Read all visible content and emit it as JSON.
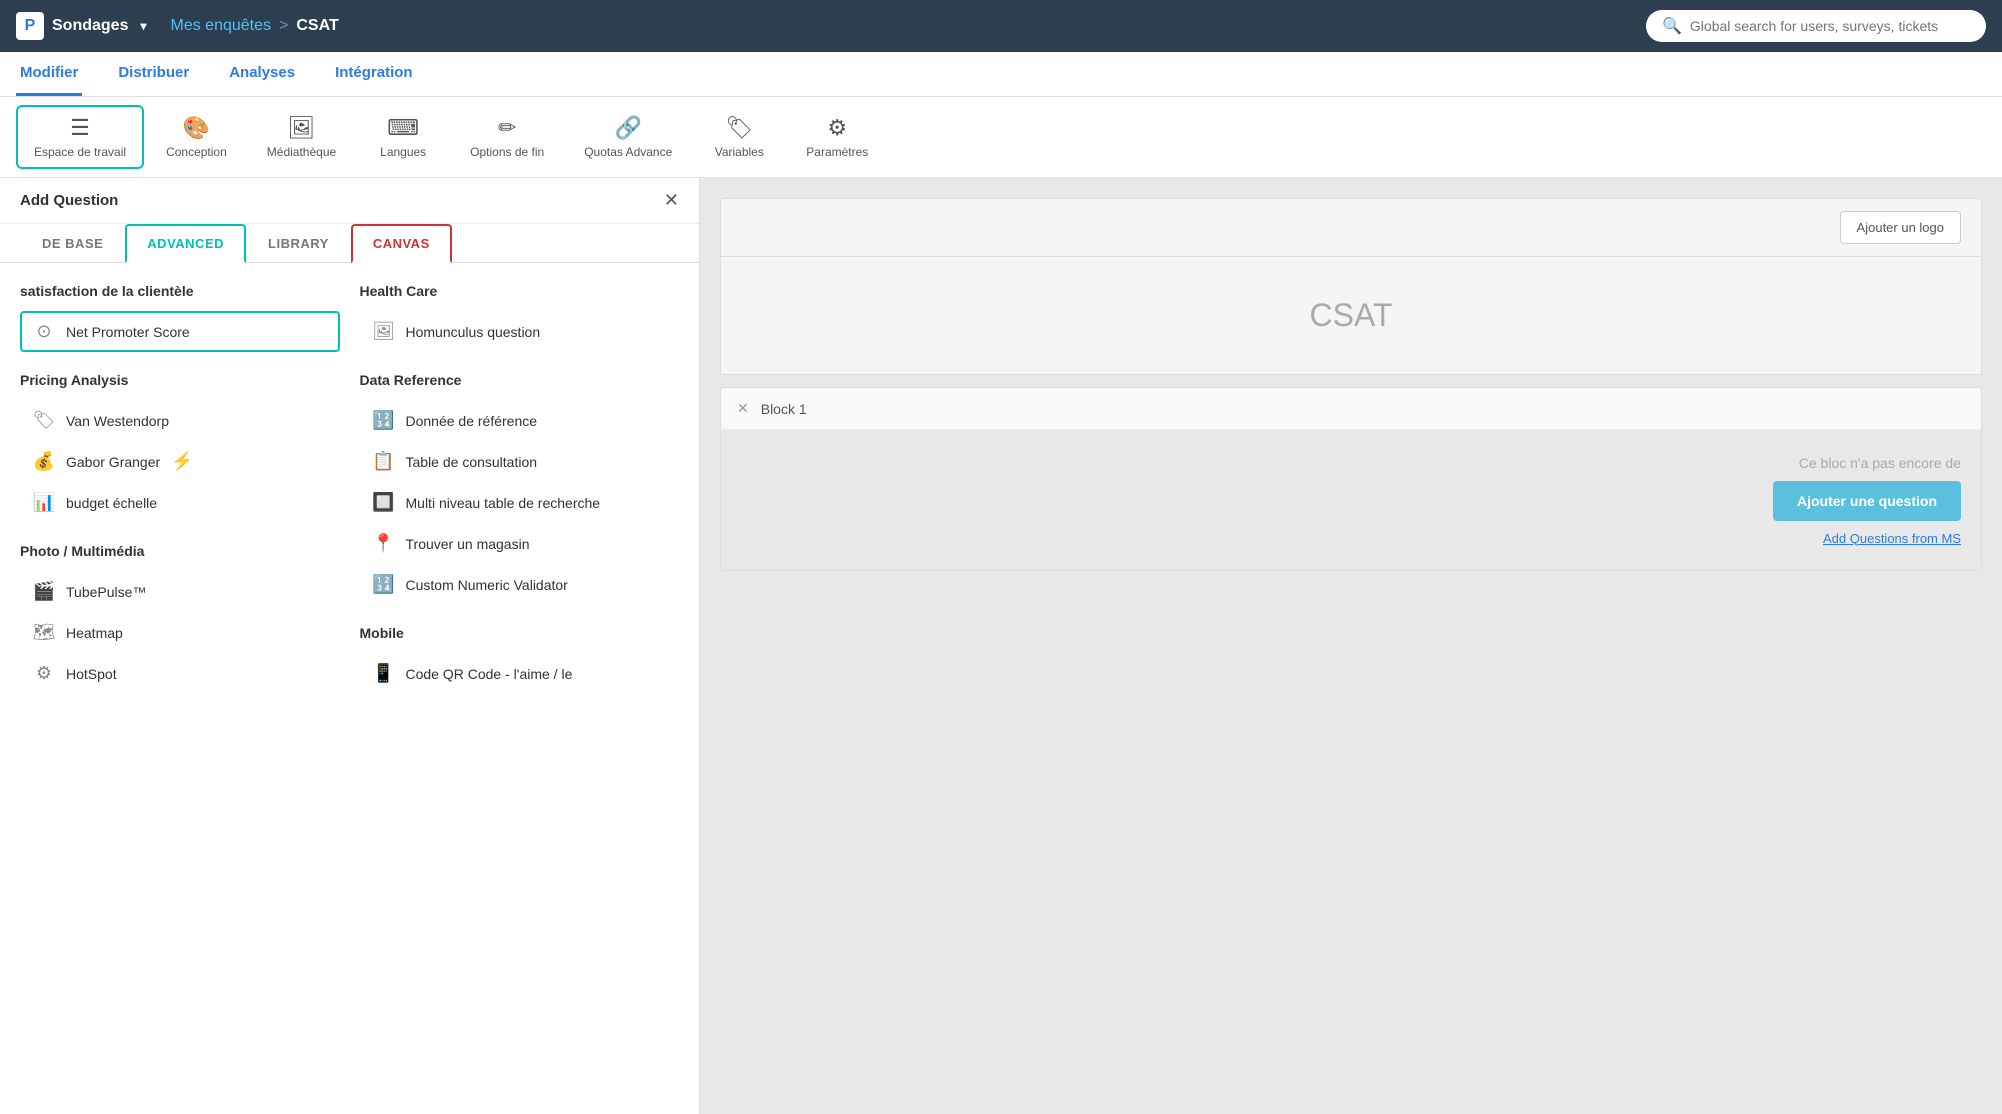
{
  "topNav": {
    "logoLetter": "P",
    "appName": "Sondages",
    "dropdownArrow": "▾",
    "breadcrumb": {
      "parent": "Mes enquêtes",
      "separator": ">",
      "current": "CSAT"
    },
    "searchPlaceholder": "Global search for users, surveys, tickets"
  },
  "subNav": {
    "items": [
      {
        "label": "Modifier",
        "active": true
      },
      {
        "label": "Distribuer",
        "active": false
      },
      {
        "label": "Analyses",
        "active": false
      },
      {
        "label": "Intégration",
        "active": false
      }
    ]
  },
  "toolbar": {
    "items": [
      {
        "label": "Espace de travail",
        "icon": "≡",
        "active": true
      },
      {
        "label": "Conception",
        "icon": "🎨",
        "active": false
      },
      {
        "label": "Médiathèque",
        "icon": "🖼",
        "active": false
      },
      {
        "label": "Langues",
        "icon": "㊙",
        "active": false
      },
      {
        "label": "Options de fin",
        "icon": "✏️",
        "active": false
      },
      {
        "label": "Quotas Advance",
        "icon": "🔗",
        "active": false
      },
      {
        "label": "Variables",
        "icon": "🏷",
        "active": false
      },
      {
        "label": "Paramètres",
        "icon": "⚙",
        "active": false
      }
    ]
  },
  "addQuestion": {
    "title": "Add Question",
    "closeIcon": "✕",
    "tabs": [
      {
        "label": "DE BASE",
        "active": false
      },
      {
        "label": "ADVANCED",
        "active": true,
        "style": "teal"
      },
      {
        "label": "LIBRARY",
        "active": false
      },
      {
        "label": "CANVAS",
        "active": false,
        "style": "red"
      }
    ],
    "leftCol": {
      "sections": [
        {
          "title": "satisfaction de la clientèle",
          "items": [
            {
              "icon": "⊙",
              "label": "Net Promoter Score",
              "highlighted": true
            }
          ]
        },
        {
          "title": "Pricing Analysis",
          "items": [
            {
              "icon": "🏷",
              "label": "Van Westendorp"
            },
            {
              "icon": "💰",
              "label": "Gabor Granger",
              "badge": "⚡"
            },
            {
              "icon": "📊",
              "label": "budget échelle"
            }
          ]
        },
        {
          "title": "Photo / Multimédia",
          "items": [
            {
              "icon": "🎬",
              "label": "TubePulse™"
            },
            {
              "icon": "🗺",
              "label": "Heatmap"
            },
            {
              "icon": "⚙",
              "label": "HotSpot"
            }
          ]
        }
      ]
    },
    "rightCol": {
      "sections": [
        {
          "title": "Health Care",
          "items": [
            {
              "icon": "🖼",
              "label": "Homunculus question"
            }
          ]
        },
        {
          "title": "Data Reference",
          "items": [
            {
              "icon": "🔢",
              "label": "Donnée de référence"
            },
            {
              "icon": "📋",
              "label": "Table de consultation"
            },
            {
              "icon": "🔲",
              "label": "Multi niveau table de recherche"
            },
            {
              "icon": "📍",
              "label": "Trouver un magasin"
            },
            {
              "icon": "🔢",
              "label": "Custom Numeric Validator"
            }
          ]
        },
        {
          "title": "Mobile",
          "items": [
            {
              "icon": "📱",
              "label": "Code QR Code - l'aime / le"
            }
          ]
        }
      ]
    }
  },
  "surveyCanvas": {
    "addLogoBtn": "Ajouter un logo",
    "surveyTitle": "CSAT",
    "blockTitle": "Block 1",
    "emptyMsg": "Ce bloc n'a pas encore de",
    "addQuestionBtn": "Ajouter une question",
    "addFromMs": "Add Questions from MS"
  }
}
